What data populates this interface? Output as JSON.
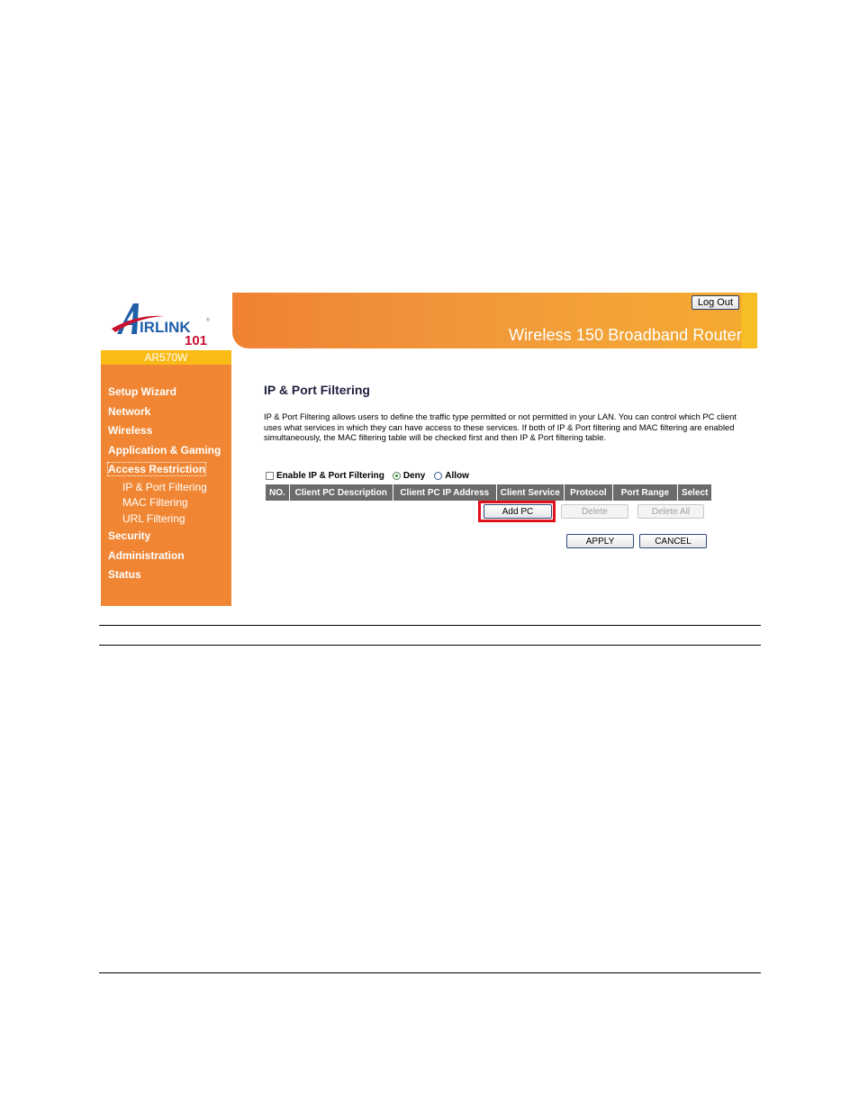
{
  "brand": {
    "logo_text": "AIRLINK",
    "logo_sub": "101",
    "model": "AR570W",
    "colors": {
      "primary_orange": "#f08633",
      "yellow": "#fbbb16",
      "logo_blue": "#1f5fa8",
      "logo_red": "#c8102e",
      "highlight_red": "#e3101c"
    }
  },
  "header": {
    "title": "Wireless 150 Broadband Router",
    "logout_label": "Log Out"
  },
  "sidebar": {
    "items": [
      {
        "label": "Setup Wizard"
      },
      {
        "label": "Network"
      },
      {
        "label": "Wireless"
      },
      {
        "label": "Application & Gaming"
      },
      {
        "label": "Access Restriction",
        "active": true,
        "sub": [
          {
            "label": "IP & Port Filtering"
          },
          {
            "label": "MAC Filtering"
          },
          {
            "label": "URL Filtering"
          }
        ]
      },
      {
        "label": "Security"
      },
      {
        "label": "Administration"
      },
      {
        "label": "Status"
      }
    ]
  },
  "main": {
    "title": "IP & Port Filtering",
    "description": "IP & Port Filtering allows users to define the traffic type permitted or not permitted in your LAN. You can control which PC client uses what services in which they can have access to these services. If both of IP & Port filtering and MAC filtering are enabled simultaneously, the MAC filtering table will be checked first and then IP & Port filtering table.",
    "enable_label": "Enable IP & Port Filtering",
    "enable_checked": false,
    "mode_options": [
      {
        "label": "Deny",
        "selected": true
      },
      {
        "label": "Allow",
        "selected": false
      }
    ],
    "table_headers": [
      "NO.",
      "Client PC Description",
      "Client PC IP Address",
      "Client Service",
      "Protocol",
      "Port Range",
      "Select"
    ],
    "buttons": {
      "add_pc": "Add PC",
      "delete": "Delete",
      "delete_all": "Delete All",
      "apply": "APPLY",
      "cancel": "CANCEL"
    }
  }
}
